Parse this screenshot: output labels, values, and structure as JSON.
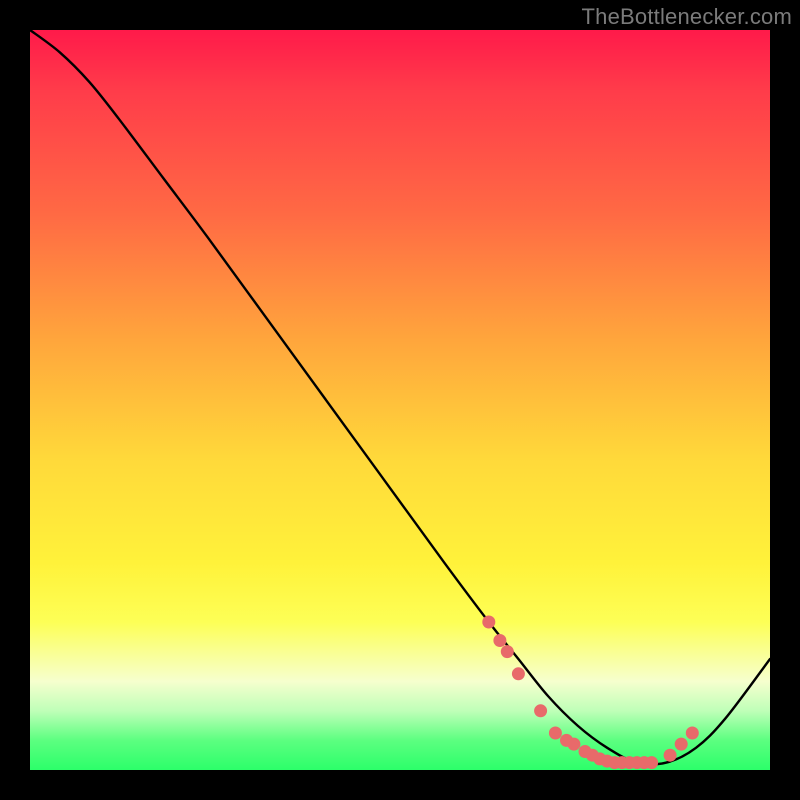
{
  "attribution": "TheBottlenecker.com",
  "chart_data": {
    "type": "line",
    "title": "",
    "xlabel": "",
    "ylabel": "",
    "xlim": [
      0,
      100
    ],
    "ylim": [
      0,
      100
    ],
    "series": [
      {
        "name": "bottleneck-curve",
        "x": [
          0,
          4,
          8,
          12,
          18,
          24,
          32,
          40,
          48,
          56,
          62,
          66,
          70,
          74,
          78,
          82,
          86,
          90,
          94,
          100
        ],
        "values": [
          100,
          97,
          93,
          88,
          80,
          72,
          61,
          50,
          39,
          28,
          20,
          15,
          10,
          6,
          3,
          1,
          1,
          3,
          7,
          15
        ]
      }
    ],
    "markers": {
      "name": "salmon-dots",
      "color": "#e86a6a",
      "x": [
        62,
        63.5,
        64.5,
        66,
        69,
        71,
        72.5,
        73.5,
        75,
        76,
        77,
        78,
        79,
        80,
        81,
        82,
        83,
        84,
        86.5,
        88,
        89.5
      ],
      "values": [
        20,
        17.5,
        16,
        13,
        8,
        5,
        4,
        3.5,
        2.5,
        2,
        1.5,
        1.2,
        1,
        1,
        1,
        1,
        1,
        1,
        2,
        3.5,
        5
      ]
    },
    "gradient_stops": [
      {
        "pos": 0,
        "color": "#ff1a4a"
      },
      {
        "pos": 25,
        "color": "#ff6a44"
      },
      {
        "pos": 58,
        "color": "#ffd93a"
      },
      {
        "pos": 88,
        "color": "#f6ffce"
      },
      {
        "pos": 100,
        "color": "#2cff6a"
      }
    ]
  }
}
